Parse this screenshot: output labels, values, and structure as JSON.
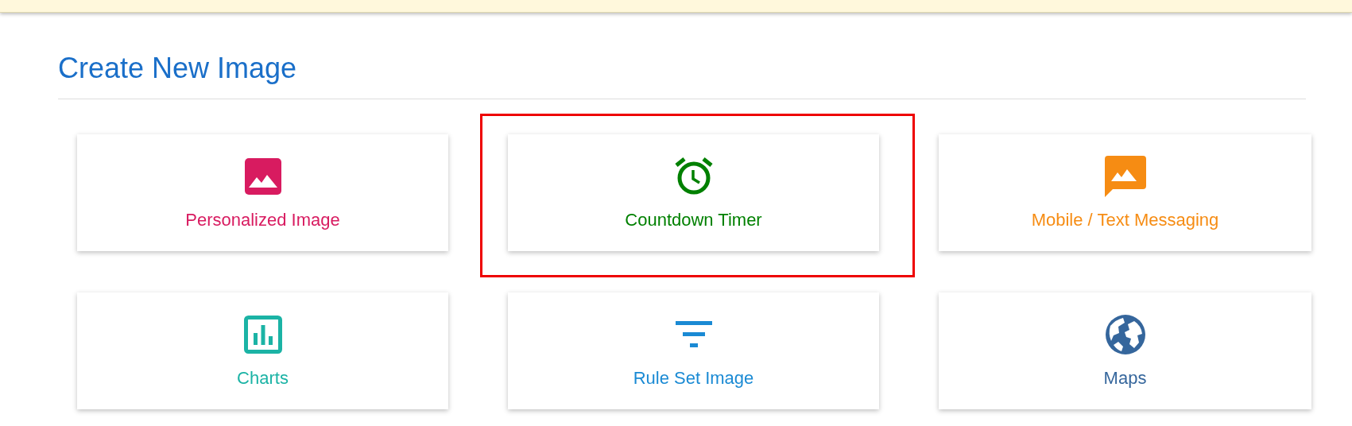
{
  "title": "Create New Image",
  "cards": [
    {
      "label": "Personalized Image",
      "color": "#d81b60",
      "highlighted": false
    },
    {
      "label": "Countdown Timer",
      "color": "#008000",
      "highlighted": true
    },
    {
      "label": "Mobile / Text Messaging",
      "color": "#f68c13",
      "highlighted": false
    },
    {
      "label": "Charts",
      "color": "#1bb3a5",
      "highlighted": false
    },
    {
      "label": "Rule Set Image",
      "color": "#1a8ad4",
      "highlighted": false
    },
    {
      "label": "Maps",
      "color": "#35669c",
      "highlighted": false
    }
  ]
}
